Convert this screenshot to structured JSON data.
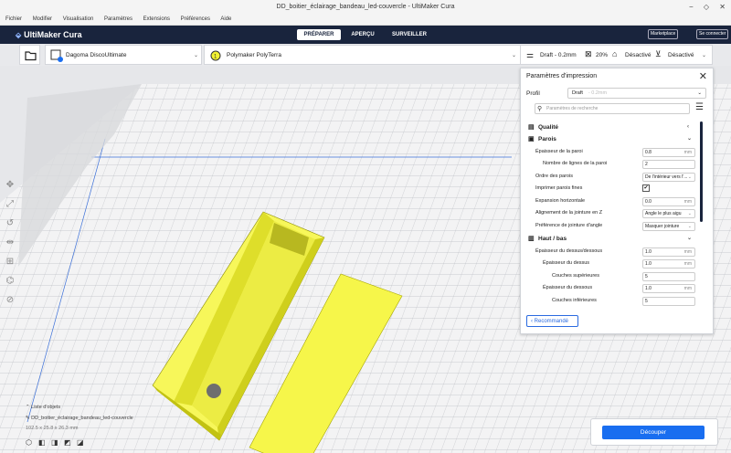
{
  "window": {
    "title": "DD_boitier_éclairage_bandeau_led-couvercle - UltiMaker Cura",
    "controls": [
      "−",
      "◇",
      "✕"
    ]
  },
  "menu": [
    "Fichier",
    "Modifier",
    "Visualisation",
    "Paramètres",
    "Extensions",
    "Préférences",
    "Aide"
  ],
  "appbar": {
    "logo": "UltiMaker Cura",
    "stages": [
      "PRÉPARER",
      "APERÇU",
      "SURVEILLER"
    ],
    "marketplace": "Marketplace",
    "signin": "Se connecter"
  },
  "toolbar": {
    "printer": "Dagoma DiscoUltimate",
    "material": "Polymaker PolyTerra",
    "profile": "Draft - 0.2mm",
    "infill": "20%",
    "support": "Désactivé",
    "adhesion": "Désactivé"
  },
  "panel": {
    "title": "Paramètres d'impression",
    "profile_label": "Profil",
    "profile_value": "Draft",
    "profile_dim": "- 0.2mm",
    "search_placeholder": "Paramètres de recherche",
    "rows": [
      {
        "type": "cat",
        "icon": "quality-icon",
        "label": "Qualité",
        "arrow": "‹"
      },
      {
        "type": "cat",
        "icon": "walls-icon",
        "label": "Parois",
        "arrow": "⌄"
      },
      {
        "label": "Épaisseur de la paroi",
        "value": "0.8",
        "unit": "mm",
        "indent": 0
      },
      {
        "label": "Nombre de lignes de la paroi",
        "value": "2",
        "unit": "",
        "indent": 1
      },
      {
        "label": "Ordre des parois",
        "value": "De l'intérieur vers l'...",
        "unit": "⌄",
        "indent": 0
      },
      {
        "label": "Imprimer parois fines",
        "check": "✔",
        "indent": 0
      },
      {
        "label": "Expansion horizontale",
        "value": "0.0",
        "unit": "mm",
        "indent": 0
      },
      {
        "label": "Alignement de la jointure en Z",
        "value": "Angle le plus aigu",
        "unit": "⌄",
        "indent": 0
      },
      {
        "label": "Préférence de jointure d'angle",
        "value": "Masquer jointure",
        "unit": "⌄",
        "indent": 0
      },
      {
        "type": "cat",
        "icon": "topbottom-icon",
        "label": "Haut / bas",
        "arrow": "⌄"
      },
      {
        "label": "Épaisseur du dessus/dessous",
        "value": "1.0",
        "unit": "mm",
        "indent": 0
      },
      {
        "label": "Épaisseur du dessus",
        "value": "1.0",
        "unit": "mm",
        "indent": 1
      },
      {
        "label": "Couches supérieures",
        "value": "5",
        "unit": "",
        "indent": 2
      },
      {
        "label": "Épaisseur du dessous",
        "value": "1.0",
        "unit": "mm",
        "indent": 1
      },
      {
        "label": "Couches inférieures",
        "value": "5",
        "unit": "",
        "indent": 2
      }
    ],
    "recommended": "Recommandé"
  },
  "footer": {
    "object_list": "Liste d'objets",
    "object_name": "DD_boitier_éclairage_bandeau_led-couvercle",
    "dimensions": "102.5 x 25.8 x 26.3 mm"
  },
  "slice": {
    "button": "Découper"
  },
  "colors": {
    "accent": "#196ef0",
    "appbar": "#19243d",
    "model": "#f2f230"
  }
}
